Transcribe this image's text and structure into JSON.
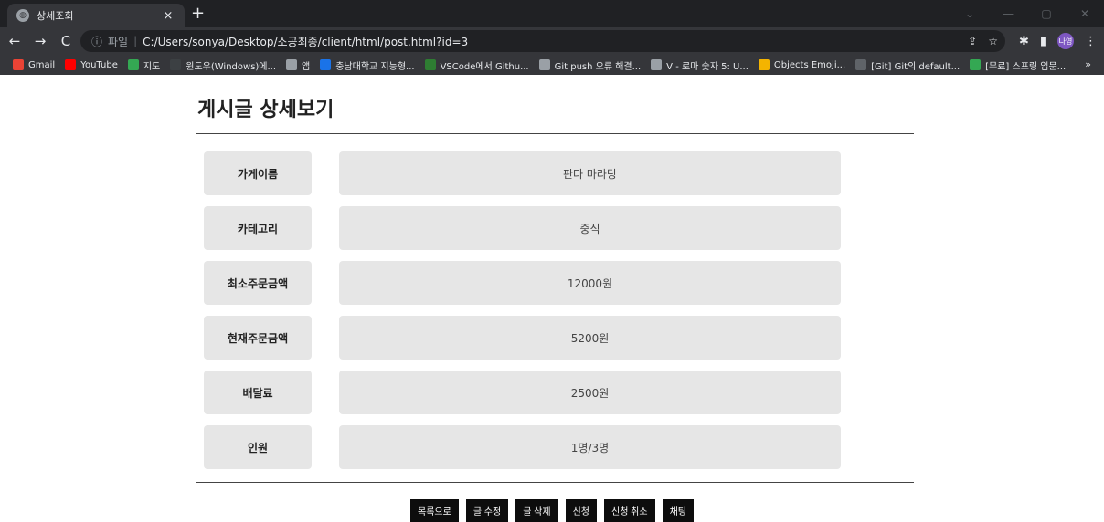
{
  "tab": {
    "title": "상세조회",
    "close": "×",
    "new_tab": "+"
  },
  "window": {
    "minimize": "—",
    "maximize": "▢",
    "close": "✕",
    "collapse": "⌄"
  },
  "nav": {
    "back": "←",
    "forward": "→",
    "reload": "C"
  },
  "omnibox": {
    "info": "ⓘ",
    "scheme": "파일",
    "separator": "|",
    "url": "C:/Users/sonya/Desktop/소공최종/client/html/post.html?id=3",
    "share": "⇪",
    "star": "☆"
  },
  "toolbar": {
    "extensions": "✱",
    "sidepanel": "▮",
    "profile": "나영",
    "menu": "⋮"
  },
  "bookmarks": [
    {
      "label": "Gmail",
      "color": "#ea4335"
    },
    {
      "label": "YouTube",
      "color": "#ff0000"
    },
    {
      "label": "지도",
      "color": "#34a853"
    },
    {
      "label": "윈도우(Windows)에...",
      "color": "#3c4043"
    },
    {
      "label": "앱",
      "color": "#9aa0a6"
    },
    {
      "label": "충남대학교 지능형...",
      "color": "#1a73e8"
    },
    {
      "label": "VSCode에서 Githu...",
      "color": "#2e7d32"
    },
    {
      "label": "Git push 오류 해결...",
      "color": "#9aa0a6"
    },
    {
      "label": "V - 로마 숫자 5: U...",
      "color": "#9aa0a6"
    },
    {
      "label": "Objects Emoji...",
      "color": "#f4b400"
    },
    {
      "label": "[Git] Git의 default...",
      "color": "#5f6368"
    },
    {
      "label": "[무료] 스프링 입문...",
      "color": "#34a853"
    }
  ],
  "bookmarks_more": "»",
  "page": {
    "title": "게시글 상세보기",
    "rows": [
      {
        "label": "가게이름",
        "value": "판다 마라탕"
      },
      {
        "label": "카테고리",
        "value": "중식"
      },
      {
        "label": "최소주문금액",
        "value": "12000원"
      },
      {
        "label": "현재주문금액",
        "value": "5200원"
      },
      {
        "label": "배달료",
        "value": "2500원"
      },
      {
        "label": "인원",
        "value": "1명/3명"
      }
    ],
    "buttons": [
      "목록으로",
      "글 수정",
      "글 삭제",
      "신청",
      "신청 취소",
      "채팅"
    ]
  }
}
